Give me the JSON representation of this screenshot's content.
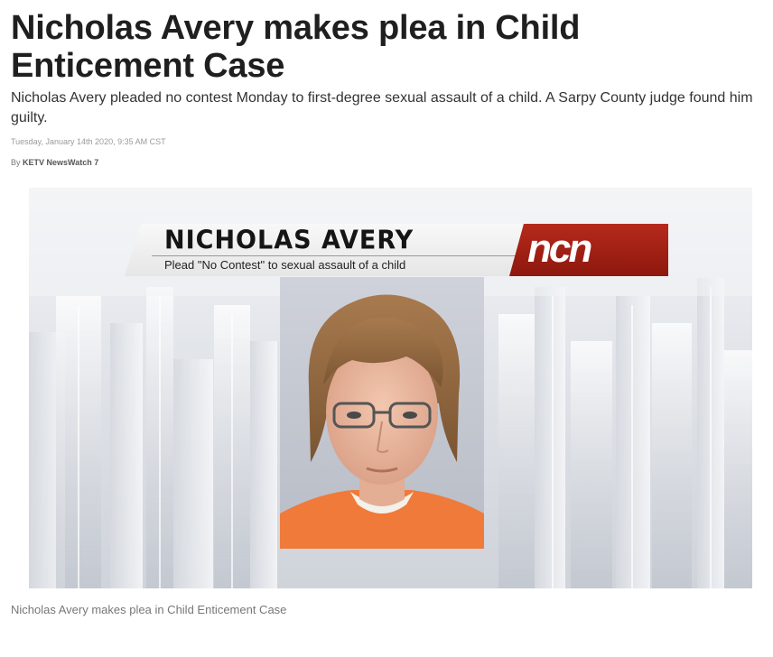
{
  "article": {
    "headline": "Nicholas Avery makes plea in Child Enticement Case",
    "summary": "Nicholas Avery pleaded no contest Monday to first-degree sexual assault of a child. A Sarpy County judge found him guilty.",
    "date": "Tuesday, January 14th 2020, 9:35 AM CST",
    "by_prefix": "By",
    "author": "KETV NewsWatch 7"
  },
  "figure": {
    "banner_name": "NICHOLAS AVERY",
    "banner_subtitle": "Plead \"No Contest\" to sexual assault of a child",
    "logo_text": "ncn",
    "mugshot_icon": "person-mugshot-photo",
    "caption": "Nicholas Avery makes plea in Child Enticement Case"
  },
  "colors": {
    "banner_red": "#a8231a",
    "text_dark": "#1f1f1f",
    "meta_gray": "#9a9a9a"
  }
}
